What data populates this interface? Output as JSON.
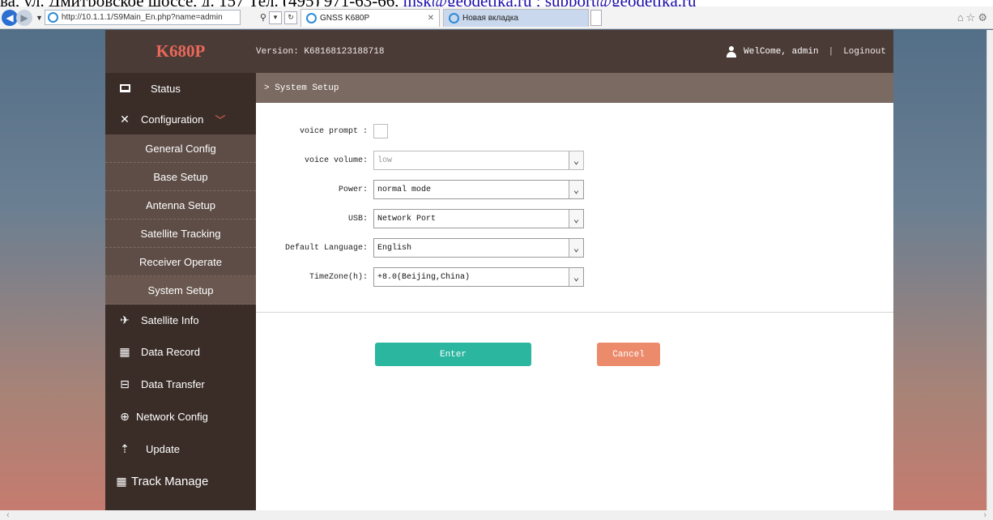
{
  "page_top_text": {
    "prefix": "ва, ул. Дмитровское шоссе, д. 157 Тел. (495) 971-63-66, ",
    "link": "msk@geodetika.ru ; support@geodetika.ru"
  },
  "browser": {
    "url": "http://10.1.1.1/S9Main_En.php?name=admin",
    "tabs": [
      {
        "label": "GNSS K680P",
        "active": true
      },
      {
        "label": "Новая вкладка",
        "active": false
      }
    ]
  },
  "header": {
    "brand": "K680P",
    "version": "Version: K68168123188718",
    "welcome": "WelCome, admin",
    "separator": "|",
    "logout": "Loginout"
  },
  "sidebar": {
    "items": [
      {
        "label": "Status",
        "icon": "monitor-icon"
      },
      {
        "label": "Configuration",
        "icon": "tools-icon"
      }
    ],
    "sub_items": [
      "General Config",
      "Base Setup",
      "Antenna Setup",
      "Satellite Tracking",
      "Receiver Operate",
      "System Setup"
    ],
    "lower_items": [
      {
        "label": "Satellite Info",
        "icon": "satellite-icon"
      },
      {
        "label": "Data Record",
        "icon": "calendar-icon"
      },
      {
        "label": "Data Transfer",
        "icon": "transfer-icon"
      },
      {
        "label": "Network Config",
        "icon": "globe-icon"
      },
      {
        "label": "Update",
        "icon": "upload-icon"
      },
      {
        "label": "Track Manage",
        "icon": "calendar-icon"
      }
    ]
  },
  "breadcrumb": "> System Setup",
  "form": {
    "voice_prompt_label": "voice prompt :",
    "voice_volume_label": "voice volume:",
    "voice_volume_value": "low",
    "power_label": "Power:",
    "power_value": "normal mode",
    "usb_label": "USB:",
    "usb_value": "Network Port",
    "language_label": "Default Language:",
    "language_value": "English",
    "timezone_label": "TimeZone(h):",
    "timezone_value": "+8.0(Beijing,China)"
  },
  "buttons": {
    "enter": "Enter",
    "cancel": "Cancel"
  },
  "colors": {
    "header_bg": "#4b3b36",
    "brand": "#e9685a",
    "enter": "#2bb6a0",
    "cancel": "#ec8b6c"
  }
}
